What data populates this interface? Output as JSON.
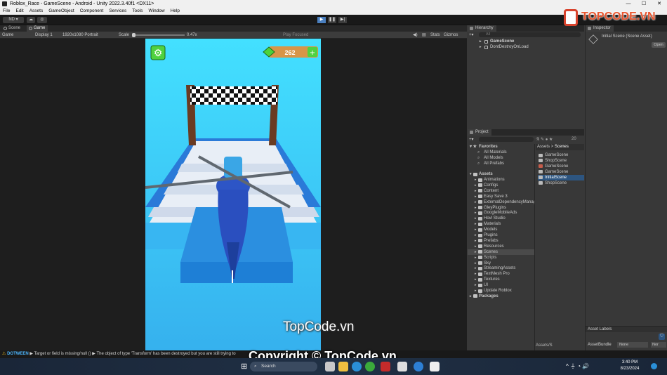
{
  "window": {
    "title": "Roblox_Race - GameScene - Android - Unity 2022.3.40f1 <DX11>",
    "controls": [
      "—",
      "☐",
      "✕"
    ]
  },
  "menu": [
    "File",
    "Edit",
    "Assets",
    "GameObject",
    "Component",
    "Services",
    "Tools",
    "Window",
    "Help"
  ],
  "toolbar": {
    "account": "ND ▾",
    "play_icons": [
      "▶",
      "❚❚",
      "▶|"
    ]
  },
  "tabs": {
    "scene": "Scene",
    "game": "Game"
  },
  "game_controls": {
    "mode": "Game",
    "display": "Display 1",
    "resolution": "1920x1080 Portrait",
    "scale_label": "Scale",
    "scale_value": "0.47x",
    "play_focused": "Play Focused",
    "stats": "Stats",
    "gizmos": "Gizmos"
  },
  "game": {
    "coins": "262",
    "settings_icon": "gear-icon",
    "currency_icon": "gem-icon",
    "add_icon": "plus-icon",
    "sky_top": "#41dcff",
    "sky_bottom": "#3ab4f0"
  },
  "hierarchy": {
    "title": "Hierarchy",
    "search_placeholder": "All",
    "items": [
      "GameScene",
      "DontDestroyOnLoad"
    ]
  },
  "project": {
    "title": "Project",
    "search_count": "20",
    "favorites_label": "Favorites",
    "favorites": [
      "All Materials",
      "All Models",
      "All Prefabs"
    ],
    "assets_label": "Assets",
    "folders": [
      "Animations",
      "Configs",
      "Content",
      "Easy Save 3",
      "ExternalDependencyManager",
      "GleyPlugins",
      "GoogleMobileAds",
      "Hovl Studio",
      "Materials",
      "Models",
      "Plugins",
      "Prefabs",
      "Resources",
      "Scenes",
      "Scripts",
      "Sky",
      "StreamingAssets",
      "TextMesh Pro",
      "Textures",
      "UI",
      "Update Roblox"
    ],
    "selected_folder": "Scenes",
    "packages_label": "Packages",
    "breadcrumb": [
      "Assets",
      ">",
      "Scenes"
    ],
    "scene_files": [
      "GameScene",
      "ShopScene",
      "GameScene",
      "GameScene",
      "InitialScene",
      "ShopScene"
    ],
    "selected_scene": "InitialScene",
    "footer_path": "Assets/S"
  },
  "inspector": {
    "title": "Inspector",
    "object_name": "Initial Scene (Scene Asset)",
    "open_button": "Open",
    "asset_labels": "Asset Labels",
    "asset_bundle_label": "AssetBundle",
    "asset_bundle_value": "None",
    "variant_value": "Nor"
  },
  "status": {
    "dotween": "DOTWEEN",
    "message": "▶ Target or field is missing/null () ▶ The object of type 'Transform' has been destroyed but you are still trying to"
  },
  "taskbar": {
    "search": "Search",
    "time": "3:40 PM",
    "date": "8/23/2024"
  },
  "watermark": {
    "copyright": "Copyright © TopCode.vn",
    "site": "TopCode.vn",
    "logo": "TOPCODE.VN"
  }
}
